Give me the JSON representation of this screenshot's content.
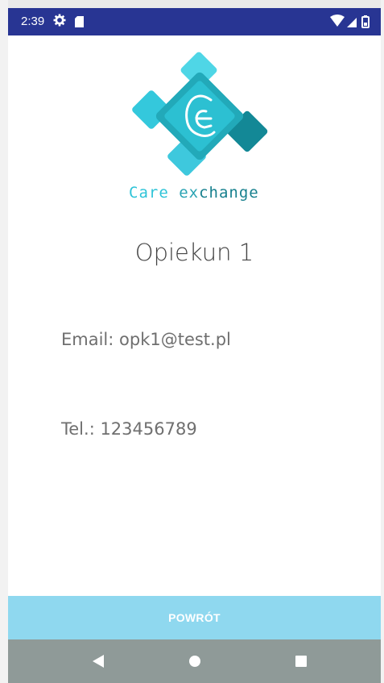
{
  "status_bar": {
    "time": "2:39",
    "icons": [
      "gear-icon",
      "sd-card-icon",
      "wifi-icon",
      "signal-icon",
      "battery-icon"
    ],
    "background": "#283593"
  },
  "logo": {
    "brand_text_1": "Care",
    "brand_text_2": "ex",
    "brand_text_3": "change",
    "colors": [
      "#2fc4d8",
      "#22a9b9",
      "#138896"
    ]
  },
  "profile": {
    "name": "Opiekun 1",
    "email_line": "Email: opk1@test.pl",
    "phone_line": "Tel.: 123456789"
  },
  "actions": {
    "back_label": "POWRÓT",
    "back_color": "#8fd8ef"
  },
  "nav_bar": {
    "buttons": [
      "back-triangle-icon",
      "home-circle-icon",
      "recents-square-icon"
    ],
    "background": "#8f9a98"
  }
}
